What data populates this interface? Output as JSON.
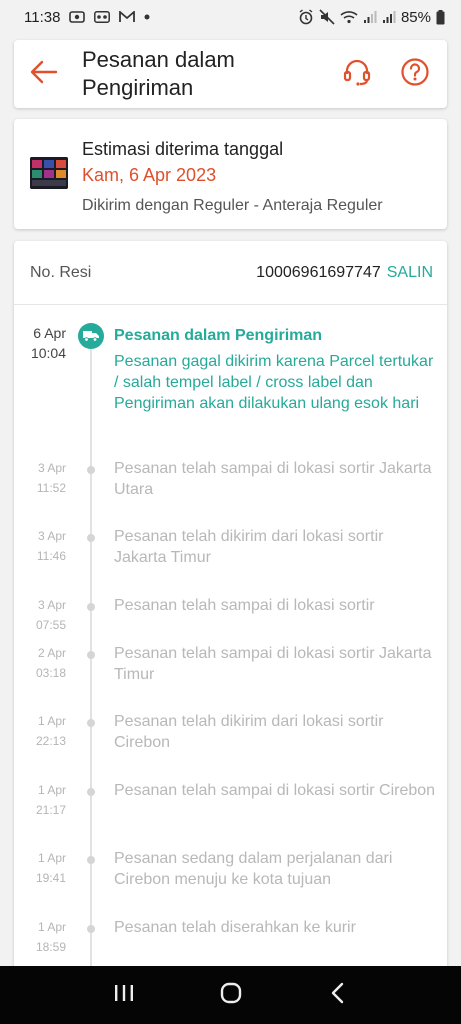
{
  "status_bar": {
    "time": "11:38",
    "battery": "85%",
    "icons_left": [
      "screen-record-icon",
      "voicemail-icon",
      "gmail-icon",
      "notification-dot-icon"
    ],
    "icons_right": [
      "alarm-icon",
      "mute-icon",
      "wifi-icon",
      "signal-icon",
      "signal-icon",
      "battery-icon"
    ]
  },
  "header": {
    "title": "Pesanan dalam Pengiriman",
    "back_icon": "arrow-left-icon",
    "support_icon": "headset-icon",
    "help_icon": "question-icon"
  },
  "estimate": {
    "label": "Estimasi diterima tanggal",
    "date": "Kam, 6 Apr 2023",
    "shipping": "Dikirim dengan Reguler - Anteraja Reguler"
  },
  "resi": {
    "label": "No. Resi",
    "number": "10006961697747",
    "copy": "SALIN"
  },
  "timeline": {
    "first": {
      "date": "6 Apr",
      "time": "10:04",
      "title": "Pesanan dalam Pengiriman",
      "description": "Pesanan gagal dikirim karena Parcel tertukar / salah tempel label / cross label dan Pengiriman akan dilakukan ulang esok hari"
    },
    "events": [
      {
        "date": "3 Apr",
        "time": "11:52",
        "text": "Pesanan telah sampai di lokasi sortir Jakarta Utara"
      },
      {
        "date": "3 Apr",
        "time": "11:46",
        "text": "Pesanan telah dikirim dari lokasi sortir Jakarta Timur"
      },
      {
        "date": "3 Apr",
        "time": "07:55",
        "text": "Pesanan telah sampai di lokasi sortir"
      },
      {
        "date": "2 Apr",
        "time": "03:18",
        "text": "Pesanan telah sampai di lokasi sortir Jakarta Timur"
      },
      {
        "date": "1 Apr",
        "time": "22:13",
        "text": "Pesanan telah dikirim dari lokasi sortir Cirebon"
      },
      {
        "date": "1 Apr",
        "time": "21:17",
        "text": "Pesanan telah sampai di lokasi sortir Cirebon"
      },
      {
        "date": "1 Apr",
        "time": "19:41",
        "text": "Pesanan sedang dalam perjalanan dari Cirebon menuju ke kota tujuan"
      },
      {
        "date": "1 Apr",
        "time": "18:59",
        "text": "Pesanan telah diserahkan ke kurir"
      }
    ]
  },
  "colors": {
    "accent": "#e0502c",
    "teal": "#26aa99",
    "muted": "#b8b8b8"
  },
  "nav_bar": {
    "buttons": [
      "recent-apps-icon",
      "home-icon",
      "back-icon"
    ]
  }
}
